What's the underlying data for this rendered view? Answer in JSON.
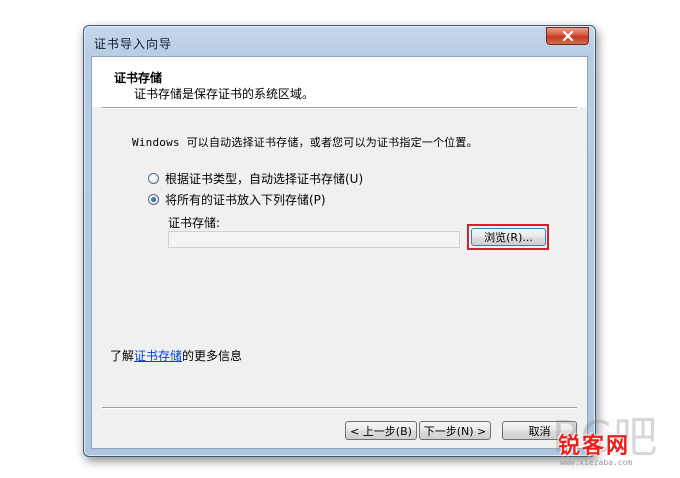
{
  "window": {
    "title": "证书导入向导"
  },
  "header": {
    "title": "证书存储",
    "subtitle": "证书存储是保存证书的系统区域。"
  },
  "content": {
    "description": "Windows 可以自动选择证书存储，或者您可以为证书指定一个位置。",
    "options": [
      {
        "label": "根据证书类型，自动选择证书存储(U)",
        "checked": false
      },
      {
        "label": "将所有的证书放入下列存储(P)",
        "checked": true
      }
    ],
    "store_label": "证书存储:",
    "store_value": "",
    "browse_label": "浏览(R)..."
  },
  "footer": {
    "learn_prefix": "了解",
    "learn_link": "证书存储",
    "learn_suffix": "的更多信息",
    "prev_label": "< 上一步(B)",
    "next_label": "下一步(N) >",
    "cancel_label": "取消"
  },
  "watermark": {
    "ghost": "PC吧",
    "brand": "锐客网",
    "url": "www.xiezaba.com"
  },
  "colors": {
    "highlight": "#d9202a",
    "link": "#0044cc",
    "brand": "#e8211e"
  },
  "icons": {
    "close": "close-icon"
  }
}
